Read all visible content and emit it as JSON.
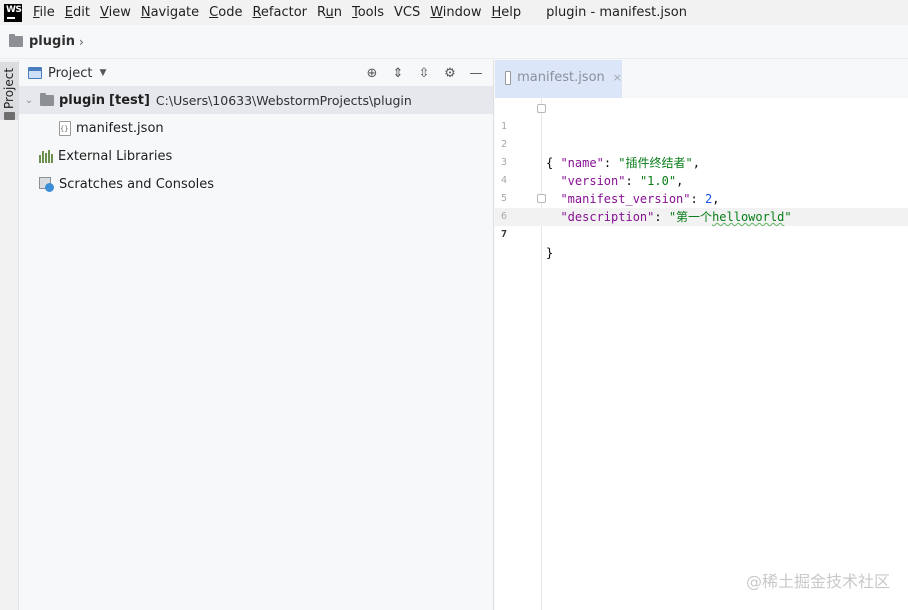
{
  "menubar": {
    "logo_text": "WS",
    "items": [
      {
        "label": "File",
        "mnemonic": "F",
        "rest": "ile"
      },
      {
        "label": "Edit",
        "mnemonic": "E",
        "rest": "dit"
      },
      {
        "label": "View",
        "mnemonic": "V",
        "rest": "iew"
      },
      {
        "label": "Navigate",
        "mnemonic": "N",
        "rest": "avigate"
      },
      {
        "label": "Code",
        "mnemonic": "C",
        "rest": "ode"
      },
      {
        "label": "Refactor",
        "mnemonic": "R",
        "rest": "efactor"
      },
      {
        "label": "Run",
        "mnemonic": "",
        "rest": "Run",
        "pre": "R",
        "mid": "u",
        "post": "n"
      },
      {
        "label": "Tools",
        "mnemonic": "T",
        "rest": "ools"
      },
      {
        "label": "VCS",
        "mnemonic": "",
        "rest": "VCS"
      },
      {
        "label": "Window",
        "mnemonic": "W",
        "rest": "indow"
      },
      {
        "label": "Help",
        "mnemonic": "H",
        "rest": "elp"
      }
    ],
    "window_title": "plugin - manifest.json"
  },
  "breadcrumb": {
    "project": "plugin",
    "chevron": "›"
  },
  "tool_strip": {
    "project_tab": "Project"
  },
  "project_panel": {
    "title": "Project",
    "caret": "▼",
    "tools": [
      {
        "name": "locate-icon",
        "glyph": "⊕"
      },
      {
        "name": "expand-all-icon",
        "glyph": "⇕"
      },
      {
        "name": "collapse-all-icon",
        "glyph": "⇳"
      },
      {
        "name": "gear-icon",
        "glyph": "⚙"
      },
      {
        "name": "minimize-icon",
        "glyph": "—"
      }
    ],
    "tree": {
      "root": {
        "arrow": "⌄",
        "label": "plugin",
        "module": "[test]",
        "path": "C:\\Users\\10633\\WebstormProjects\\plugin"
      },
      "file": "manifest.json",
      "external_libraries": "External Libraries",
      "scratches": "Scratches and Consoles"
    }
  },
  "editor": {
    "tab_label": "manifest.json",
    "tab_close": "×",
    "lines": [
      {
        "n": "1",
        "text": "{"
      },
      {
        "n": "2",
        "indent": "  ",
        "key": "\"name\"",
        "sep": ": ",
        "val": "\"插件终结者\"",
        "val_type": "str",
        "end": ","
      },
      {
        "n": "3",
        "indent": "  ",
        "key": "\"version\"",
        "sep": ": ",
        "val": "\"1.0\"",
        "val_type": "str",
        "end": ","
      },
      {
        "n": "4",
        "indent": "  ",
        "key": "\"manifest_version\"",
        "sep": ": ",
        "val": "2",
        "val_type": "num",
        "end": ","
      },
      {
        "n": "5",
        "indent": "  ",
        "key": "\"description\"",
        "sep": ": ",
        "val_pre": "\"第一个",
        "val_typo": "helloworld",
        "val_post": "\""
      },
      {
        "n": "6",
        "text": "}"
      },
      {
        "n": "7",
        "text": ""
      }
    ]
  },
  "watermark": "@稀土掘金技术社区"
}
